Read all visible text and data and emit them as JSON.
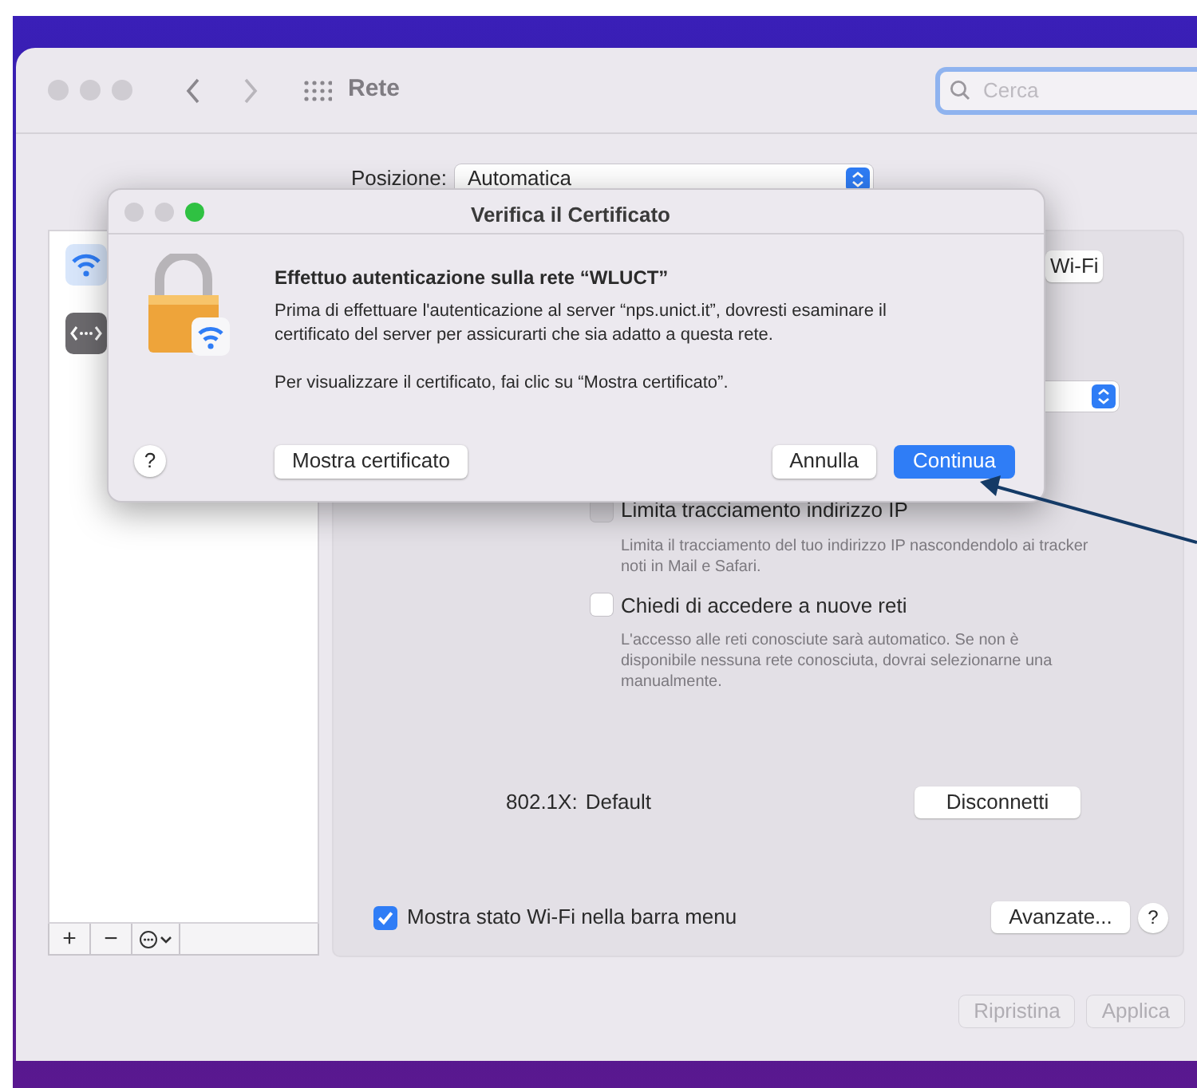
{
  "window": {
    "title": "Rete",
    "search": {
      "placeholder": "Cerca"
    }
  },
  "location": {
    "label": "Posizione:",
    "value": "Automatica"
  },
  "sidebar": {
    "items": [
      {
        "kind": "wifi"
      },
      {
        "kind": "ethernet"
      }
    ],
    "toolbar": [
      "+",
      "−"
    ]
  },
  "panel": {
    "wifi_button": "Wi-Fi",
    "options": [
      {
        "label": "Limita tracciamento indirizzo IP",
        "checked": false,
        "disabled": true,
        "description": "Limita il tracciamento del tuo indirizzo IP nascondendolo ai tracker noti in Mail e Safari."
      },
      {
        "label": "Chiedi di accedere a nuove reti",
        "checked": false,
        "disabled": false,
        "description": "L'accesso alle reti conosciute sarà automatico. Se non è disponibile nessuna rete conosciuta, dovrai selezionarne una manualmente."
      }
    ],
    "auth": {
      "label": "802.1X:",
      "value": "Default"
    },
    "disconnect_button": "Disconnetti",
    "menu_checkbox": {
      "label": "Mostra stato Wi-Fi nella barra menu",
      "checked": true
    },
    "advanced_button": "Avanzate...",
    "help": "?"
  },
  "footer_buttons": [
    {
      "label": "Ripristina",
      "disabled": true
    },
    {
      "label": "Applica",
      "disabled": true
    }
  ],
  "dialog": {
    "title": "Verifica il Certificato",
    "heading": "Effettuo autenticazione sulla rete “WLUCT”",
    "message": "Prima di effettuare l'autenticazione al server “nps.unict.it”, dovresti esaminare il certificato del server per assicurarti che sia adatto a questa rete.",
    "hint": "Per visualizzare il certificato, fai clic su “Mostra certificato”.",
    "help": "?",
    "buttons": [
      {
        "label": "Mostra certificato",
        "kind": "secondary"
      },
      {
        "label": "Annulla",
        "kind": "secondary"
      },
      {
        "label": "Continua",
        "kind": "default"
      }
    ]
  }
}
